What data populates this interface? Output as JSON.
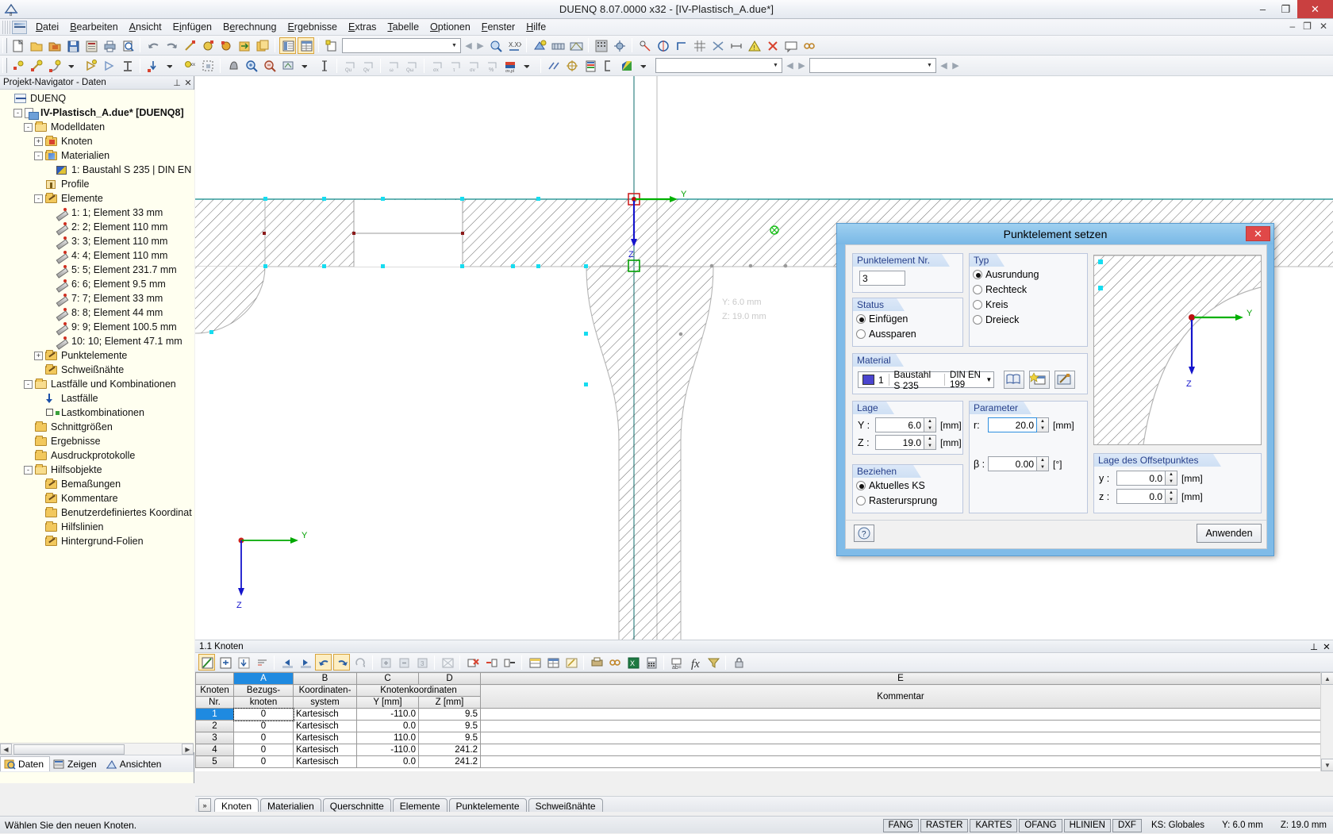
{
  "window": {
    "title": "DUENQ 8.07.0000 x32 - [IV-Plastisch_A.due*]",
    "minimize": "–",
    "maximize": "❐",
    "close": "✕",
    "inner_minimize": "–",
    "inner_restore": "❐",
    "inner_close": "✕"
  },
  "menu": {
    "items": [
      {
        "label": "Datei"
      },
      {
        "label": "Bearbeiten"
      },
      {
        "label": "Ansicht"
      },
      {
        "label": "Einfügen"
      },
      {
        "label": "Berechnung"
      },
      {
        "label": "Ergebnisse"
      },
      {
        "label": "Extras"
      },
      {
        "label": "Tabelle"
      },
      {
        "label": "Optionen"
      },
      {
        "label": "Fenster"
      },
      {
        "label": "Hilfe"
      }
    ]
  },
  "toolbar": {
    "combo1_value": "",
    "combo2_value": "",
    "combo3_value": "",
    "prev_label": "◀",
    "next_label": "▶"
  },
  "navigator": {
    "title": "Projekt-Navigator - Daten",
    "pin_icon": "pin-icon",
    "close_icon": "close-icon",
    "tree": [
      {
        "depth": 0,
        "label": "DUENQ",
        "icon": "app-icon",
        "exp": "",
        "bold": false
      },
      {
        "depth": 1,
        "label": "IV-Plastisch_A.due* [DUENQ8]",
        "icon": "doc-icon",
        "exp": "-",
        "bold": true
      },
      {
        "depth": 2,
        "label": "Modelldaten",
        "icon": "folder-open",
        "exp": "-",
        "bold": false
      },
      {
        "depth": 3,
        "label": "Knoten",
        "icon": "folder-mark",
        "exp": "+",
        "bold": false
      },
      {
        "depth": 3,
        "label": "Materialien",
        "icon": "folder-blue",
        "exp": "-",
        "bold": false
      },
      {
        "depth": 4,
        "label": "1: Baustahl S 235 | DIN EN",
        "icon": "material-icon",
        "exp": "",
        "bold": false
      },
      {
        "depth": 3,
        "label": "Profile",
        "icon": "profile-icon",
        "exp": "",
        "bold": false
      },
      {
        "depth": 3,
        "label": "Elemente",
        "icon": "folder-pen",
        "exp": "-",
        "bold": false
      },
      {
        "depth": 4,
        "label": "1: 1; Element 33 mm",
        "icon": "element-icon",
        "exp": "",
        "bold": false
      },
      {
        "depth": 4,
        "label": "2: 2; Element 110 mm",
        "icon": "element-icon",
        "exp": "",
        "bold": false
      },
      {
        "depth": 4,
        "label": "3: 3; Element 110 mm",
        "icon": "element-icon",
        "exp": "",
        "bold": false
      },
      {
        "depth": 4,
        "label": "4: 4; Element 110 mm",
        "icon": "element-icon",
        "exp": "",
        "bold": false
      },
      {
        "depth": 4,
        "label": "5: 5; Element 231.7 mm",
        "icon": "element-icon",
        "exp": "",
        "bold": false
      },
      {
        "depth": 4,
        "label": "6: 6; Element 9.5 mm",
        "icon": "element-icon",
        "exp": "",
        "bold": false
      },
      {
        "depth": 4,
        "label": "7: 7; Element 33 mm",
        "icon": "element-icon",
        "exp": "",
        "bold": false
      },
      {
        "depth": 4,
        "label": "8: 8; Element 44 mm",
        "icon": "element-icon",
        "exp": "",
        "bold": false
      },
      {
        "depth": 4,
        "label": "9: 9; Element 100.5 mm",
        "icon": "element-icon",
        "exp": "",
        "bold": false
      },
      {
        "depth": 4,
        "label": "10: 10; Element 47.1 mm",
        "icon": "element-icon",
        "exp": "",
        "bold": false
      },
      {
        "depth": 3,
        "label": "Punktelemente",
        "icon": "folder-pen",
        "exp": "+",
        "bold": false
      },
      {
        "depth": 3,
        "label": "Schweißnähte",
        "icon": "folder-pen",
        "exp": "",
        "bold": false
      },
      {
        "depth": 2,
        "label": "Lastfälle und Kombinationen",
        "icon": "folder-open",
        "exp": "-",
        "bold": false
      },
      {
        "depth": 3,
        "label": "Lastfälle",
        "icon": "arrow-icon",
        "exp": "",
        "bold": false
      },
      {
        "depth": 3,
        "label": "Lastkombinationen",
        "icon": "komb-icon",
        "exp": "",
        "bold": false
      },
      {
        "depth": 2,
        "label": "Schnittgrößen",
        "icon": "folder",
        "exp": "",
        "bold": false
      },
      {
        "depth": 2,
        "label": "Ergebnisse",
        "icon": "folder",
        "exp": "",
        "bold": false
      },
      {
        "depth": 2,
        "label": "Ausdruckprotokolle",
        "icon": "folder",
        "exp": "",
        "bold": false
      },
      {
        "depth": 2,
        "label": "Hilfsobjekte",
        "icon": "folder-open",
        "exp": "-",
        "bold": false
      },
      {
        "depth": 3,
        "label": "Bemaßungen",
        "icon": "folder-pen",
        "exp": "",
        "bold": false
      },
      {
        "depth": 3,
        "label": "Kommentare",
        "icon": "folder-pen",
        "exp": "",
        "bold": false
      },
      {
        "depth": 3,
        "label": "Benutzerdefiniertes Koordinat",
        "icon": "folder",
        "exp": "",
        "bold": false
      },
      {
        "depth": 3,
        "label": "Hilfslinien",
        "icon": "folder",
        "exp": "",
        "bold": false
      },
      {
        "depth": 3,
        "label": "Hintergrund-Folien",
        "icon": "folder-pen",
        "exp": "",
        "bold": false
      }
    ],
    "tabs": [
      {
        "label": "Daten",
        "icon": "data-icon",
        "selected": true
      },
      {
        "label": "Zeigen",
        "icon": "show-icon",
        "selected": false
      },
      {
        "label": "Ansichten",
        "icon": "views-icon",
        "selected": false
      }
    ]
  },
  "canvas": {
    "axis_y_label": "Y",
    "axis_z_label": "Z",
    "cursor_readout_y": "Y:  6.0 mm",
    "cursor_readout_z": "Z:  19.0 mm"
  },
  "dialog": {
    "title": "Punktelement setzen",
    "close_label": "✕",
    "point_no": {
      "caption": "Punktelement Nr.",
      "value": "3"
    },
    "status": {
      "caption": "Status",
      "options": [
        {
          "label": "Einfügen",
          "selected": true
        },
        {
          "label": "Aussparen",
          "selected": false
        }
      ]
    },
    "typ": {
      "caption": "Typ",
      "options": [
        {
          "label": "Ausrundung",
          "selected": true
        },
        {
          "label": "Rechteck",
          "selected": false
        },
        {
          "label": "Kreis",
          "selected": false
        },
        {
          "label": "Dreieck",
          "selected": false
        }
      ]
    },
    "material": {
      "caption": "Material",
      "number": "1",
      "name": "Baustahl S 235",
      "standard": "DIN EN 199",
      "color": "#4b45cf",
      "buttons": [
        "library-icon",
        "new-material-icon",
        "edit-material-icon"
      ]
    },
    "lage": {
      "caption": "Lage",
      "y_label": "Y :",
      "y_value": "6.0",
      "y_unit": "[mm]",
      "z_label": "Z :",
      "z_value": "19.0",
      "z_unit": "[mm]"
    },
    "parameter": {
      "caption": "Parameter",
      "r_label": "r:",
      "r_value": "20.0",
      "r_unit": "[mm]",
      "b_label": "β :",
      "b_value": "0.00",
      "b_unit": "[°]"
    },
    "beziehen": {
      "caption": "Beziehen auf",
      "options": [
        {
          "label": "Aktuelles KS",
          "selected": true
        },
        {
          "label": "Rasterursprung",
          "selected": false
        }
      ]
    },
    "offset": {
      "caption": "Lage des Offsetpunktes",
      "y_label": "y :",
      "y_value": "0.0",
      "y_unit": "[mm]",
      "z_label": "z :",
      "z_value": "0.0",
      "z_unit": "[mm]"
    },
    "preview": {
      "axis_y": "Y",
      "axis_z": "Z"
    },
    "help_icon": "help-icon",
    "apply_button": "Anwenden"
  },
  "table": {
    "title": "1.1 Knoten",
    "pin_icon": "pin-icon",
    "close_icon": "close-icon",
    "columns": [
      "A",
      "B",
      "C",
      "D",
      "E"
    ],
    "selected_column": "A",
    "headers": {
      "row_label_top": "Knoten",
      "row_label_bottom": "Nr.",
      "a_top": "Bezugs-",
      "a_bottom": "knoten",
      "b_top": "Koordinaten-",
      "b_bottom": "system",
      "cd_top": "Knotenkoordinaten",
      "c_bottom": "Y [mm]",
      "d_bottom": "Z [mm]",
      "e": "Kommentar"
    },
    "rows": [
      {
        "no": "1",
        "bezug": "0",
        "ks": "Kartesisch",
        "y": "-110.0",
        "z": "9.5",
        "comment": "",
        "selected": true
      },
      {
        "no": "2",
        "bezug": "0",
        "ks": "Kartesisch",
        "y": "0.0",
        "z": "9.5",
        "comment": "",
        "selected": false
      },
      {
        "no": "3",
        "bezug": "0",
        "ks": "Kartesisch",
        "y": "110.0",
        "z": "9.5",
        "comment": "",
        "selected": false
      },
      {
        "no": "4",
        "bezug": "0",
        "ks": "Kartesisch",
        "y": "-110.0",
        "z": "241.2",
        "comment": "",
        "selected": false
      },
      {
        "no": "5",
        "bezug": "0",
        "ks": "Kartesisch",
        "y": "0.0",
        "z": "241.2",
        "comment": "",
        "selected": false
      }
    ],
    "tabs": [
      {
        "label": "Knoten",
        "selected": true
      },
      {
        "label": "Materialien",
        "selected": false
      },
      {
        "label": "Querschnitte",
        "selected": false
      },
      {
        "label": "Elemente",
        "selected": false
      },
      {
        "label": "Punktelemente",
        "selected": false
      },
      {
        "label": "Schweißnähte",
        "selected": false
      }
    ]
  },
  "status": {
    "message": "Wählen Sie den neuen Knoten.",
    "toggles": [
      "FANG",
      "RASTER",
      "KARTES",
      "OFANG",
      "HLINIEN",
      "DXF"
    ],
    "ks": "KS: Globales",
    "y": "Y:  6.0 mm",
    "z": "Z:  19.0 mm"
  }
}
